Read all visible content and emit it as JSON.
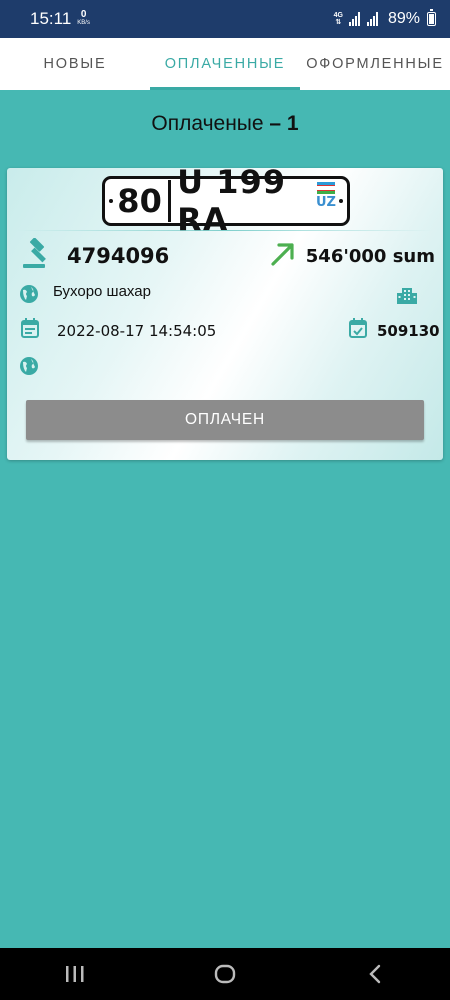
{
  "status": {
    "time": "15:11",
    "net_speed_value": "0",
    "net_speed_unit": "KB/s",
    "network": "4G",
    "battery": "89%"
  },
  "tabs": [
    {
      "label": "НОВЫЕ",
      "active": false
    },
    {
      "label": "ОПЛАЧЕННЫЕ",
      "active": true
    },
    {
      "label": "ОФОРМЛЕННЫЕ",
      "active": false
    }
  ],
  "heading": {
    "text": "Оплаченые",
    "count": " – 1"
  },
  "card": {
    "plate": {
      "region": "80",
      "number": "U 199 RA",
      "country": "UZ"
    },
    "lot_number": "4794096",
    "price": "546'000 sum",
    "city": "Бухоро шахар",
    "date": "2022-08-17 14:54:05",
    "code": "509130",
    "button_label": "ОПЛАЧЕН"
  },
  "colors": {
    "background": "#46b8b3",
    "accent": "#3aaaa5",
    "statusbar": "#1e3c6b",
    "button": "#8c8c8c",
    "arrow": "#4caf50"
  },
  "icons": {
    "gavel": "gavel-icon",
    "arrow": "trending-up-icon",
    "globe": "globe-icon",
    "building": "building-icon",
    "calendar": "calendar-icon",
    "calendar_check": "calendar-check-icon"
  }
}
